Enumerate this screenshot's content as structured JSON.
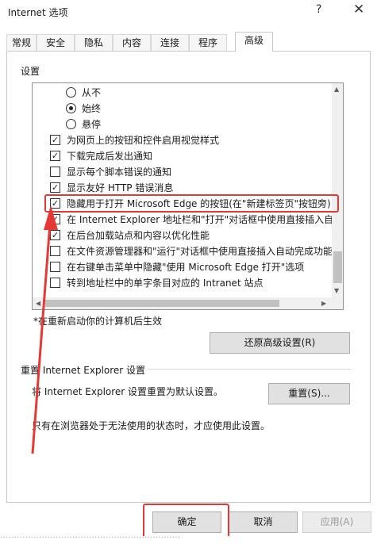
{
  "window": {
    "title": "Internet 选项",
    "help_glyph": "?",
    "close_glyph": "✕"
  },
  "tabs": [
    {
      "label": "常规",
      "active": false
    },
    {
      "label": "安全",
      "active": false
    },
    {
      "label": "隐私",
      "active": false
    },
    {
      "label": "内容",
      "active": false
    },
    {
      "label": "连接",
      "active": false
    },
    {
      "label": "程序",
      "active": false
    },
    {
      "label": "高级",
      "active": true
    }
  ],
  "settings": {
    "group_label": "设置",
    "items": [
      {
        "type": "radio",
        "label": "从不",
        "checked": false
      },
      {
        "type": "radio",
        "label": "始终",
        "checked": true
      },
      {
        "type": "radio",
        "label": "悬停",
        "checked": false
      },
      {
        "type": "checkbox",
        "label": "为网页上的按钮和控件启用视觉样式",
        "checked": true
      },
      {
        "type": "checkbox",
        "label": "下载完成后发出通知",
        "checked": true
      },
      {
        "type": "checkbox",
        "label": "显示每个脚本错误的通知",
        "checked": false
      },
      {
        "type": "checkbox",
        "label": "显示友好 HTTP 错误消息",
        "checked": true
      },
      {
        "type": "checkbox",
        "label": "隐藏用于打开 Microsoft Edge 的按钮(在\"新建标签页\"按钮旁)",
        "checked": true
      },
      {
        "type": "checkbox",
        "label": "在 Internet Explorer 地址栏和\"打开\"对话框中使用直接插入自",
        "checked": true
      },
      {
        "type": "checkbox",
        "label": "在后台加载站点和内容以优化性能",
        "checked": true
      },
      {
        "type": "checkbox",
        "label": "在文件资源管理器和\"运行\"对话框中使用直接插入自动完成功能",
        "checked": false
      },
      {
        "type": "checkbox",
        "label": "在右键单击菜单中隐藏\"使用 Microsoft Edge 打开\"选项",
        "checked": false
      },
      {
        "type": "checkbox",
        "label": "转到地址栏中的单字条目对应的 Intranet 站点",
        "checked": false
      }
    ],
    "restart_note": "*在重新启动你的计算机后生效",
    "restore_button": "还原高级设置(R)"
  },
  "reset": {
    "group_label": "重置 Internet Explorer 设置",
    "description": "将 Internet Explorer 设置重置为默认设置。",
    "button": "重置(S)...",
    "note": "只有在浏览器处于无法使用的状态时，才应使用此设置。"
  },
  "footer": {
    "ok": "确定",
    "cancel": "取消",
    "apply": "应用(A)"
  },
  "annotation": {
    "color": "#e53935"
  }
}
